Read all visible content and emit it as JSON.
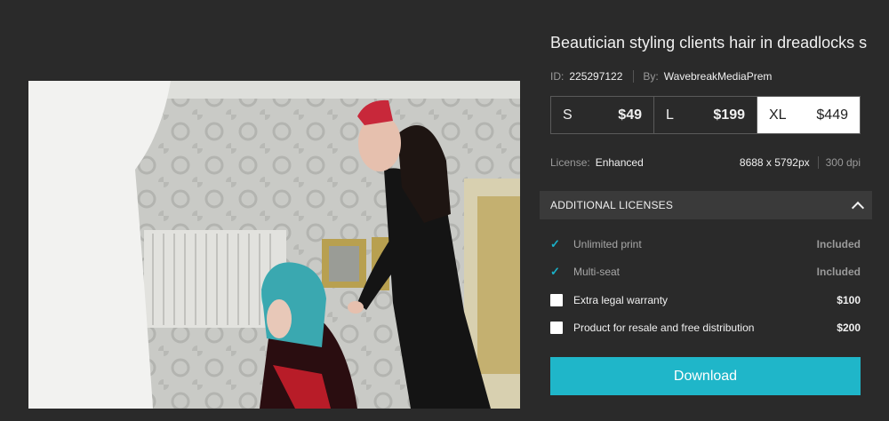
{
  "image": {
    "title": "Beautician styling clients hair in dreadlocks s...",
    "id_label": "ID:",
    "id": "225297122",
    "by_label": "By:",
    "author": "WavebreakMediaPrem"
  },
  "sizes": [
    {
      "name": "S",
      "price": "$49",
      "selected": false
    },
    {
      "name": "L",
      "price": "$199",
      "selected": false
    },
    {
      "name": "XL",
      "price": "$449",
      "selected": true
    }
  ],
  "license": {
    "label": "License:",
    "value": "Enhanced",
    "dimensions": "8688 x 5792px",
    "dpi": "300 dpi"
  },
  "additional": {
    "header": "ADDITIONAL LICENSES",
    "expanded": true,
    "options": [
      {
        "label": "Unlimited print",
        "price": "Included",
        "included": true
      },
      {
        "label": "Multi-seat",
        "price": "Included",
        "included": true
      },
      {
        "label": "Extra legal warranty",
        "price": "$100",
        "included": false
      },
      {
        "label": "Product for resale and free distribution",
        "price": "$200",
        "included": false
      }
    ]
  },
  "download_label": "Download",
  "colors": {
    "accent": "#1fb6c9",
    "background": "#2a2a2a"
  }
}
